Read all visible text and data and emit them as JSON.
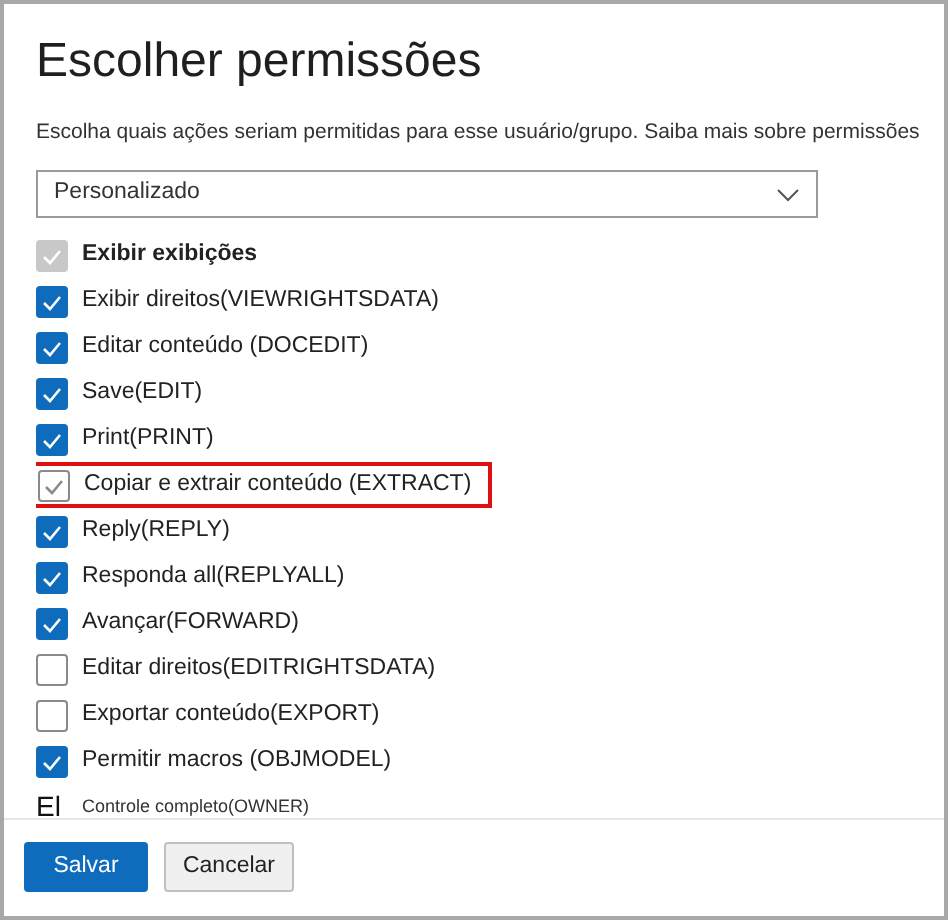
{
  "title": "Escolher permissões",
  "description": "Escolha quais ações seriam permitidas para esse usuário/grupo. Saiba mais sobre permissões",
  "dropdown": {
    "value": "Personalizado"
  },
  "permissions": [
    {
      "label": "Exibir exibições",
      "checked": true,
      "kind": "disabled",
      "highlighted": false
    },
    {
      "label": "Exibir direitos(VIEWRIGHTSDATA)",
      "checked": true,
      "kind": "filled",
      "highlighted": false
    },
    {
      "label": "Editar conteúdo (DOCEDIT)",
      "checked": true,
      "kind": "filled",
      "highlighted": false
    },
    {
      "label": "Save(EDIT)",
      "checked": true,
      "kind": "filled",
      "highlighted": false
    },
    {
      "label": "Print(PRINT)",
      "checked": true,
      "kind": "filled",
      "highlighted": false
    },
    {
      "label": "Copiar e extrair conteúdo (EXTRACT)",
      "checked": true,
      "kind": "outline",
      "highlighted": true
    },
    {
      "label": "Reply(REPLY)",
      "checked": true,
      "kind": "filled",
      "highlighted": false
    },
    {
      "label": "Responda all(REPLYALL)",
      "checked": true,
      "kind": "filled",
      "highlighted": false
    },
    {
      "label": "Avançar(FORWARD)",
      "checked": true,
      "kind": "filled",
      "highlighted": false
    },
    {
      "label": "Editar direitos(EDITRIGHTSDATA)",
      "checked": false,
      "kind": "filled",
      "highlighted": false
    },
    {
      "label": "Exportar conteúdo(EXPORT)",
      "checked": false,
      "kind": "filled",
      "highlighted": false
    },
    {
      "label": "Permitir macros (OBJMODEL)",
      "checked": true,
      "kind": "filled",
      "highlighted": false
    },
    {
      "label": "Controle completo(OWNER)",
      "kind": "text",
      "marker": "El"
    }
  ],
  "buttons": [
    {
      "label": "Salvar",
      "kind": "primary"
    },
    {
      "label": "Cancelar",
      "kind": "secondary"
    }
  ]
}
